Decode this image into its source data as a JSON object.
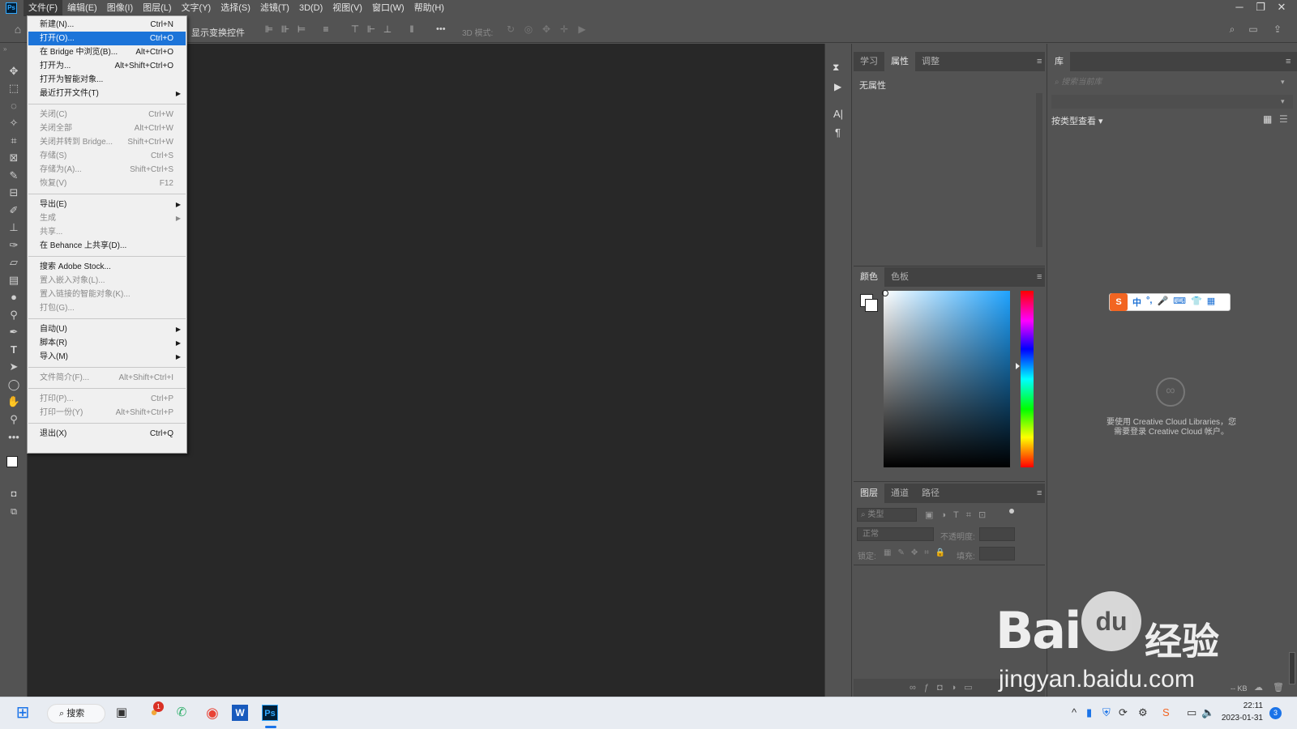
{
  "app": {
    "logo": "Ps"
  },
  "menubar": [
    {
      "label": "文件(F)",
      "active": true
    },
    {
      "label": "编辑(E)"
    },
    {
      "label": "图像(I)"
    },
    {
      "label": "图层(L)"
    },
    {
      "label": "文字(Y)"
    },
    {
      "label": "选择(S)"
    },
    {
      "label": "滤镜(T)"
    },
    {
      "label": "3D(D)"
    },
    {
      "label": "视图(V)"
    },
    {
      "label": "窗口(W)"
    },
    {
      "label": "帮助(H)"
    }
  ],
  "window_controls": {
    "minimize": "─",
    "restore": "❐",
    "close": "✕"
  },
  "options_bar": {
    "show_transform": "显示变换控件",
    "mode_3d": "3D 模式:",
    "more": "•••"
  },
  "file_menu": {
    "items": [
      {
        "label": "新建(N)...",
        "shortcut": "Ctrl+N"
      },
      {
        "label": "打开(O)...",
        "shortcut": "Ctrl+O",
        "highlight": true
      },
      {
        "label": "在 Bridge 中浏览(B)...",
        "shortcut": "Alt+Ctrl+O"
      },
      {
        "label": "打开为...",
        "shortcut": "Alt+Shift+Ctrl+O"
      },
      {
        "label": "打开为智能对象..."
      },
      {
        "label": "最近打开文件(T)",
        "submenu": true
      },
      {
        "sep": true
      },
      {
        "label": "关闭(C)",
        "shortcut": "Ctrl+W",
        "disabled": true
      },
      {
        "label": "关闭全部",
        "shortcut": "Alt+Ctrl+W",
        "disabled": true
      },
      {
        "label": "关闭并转到 Bridge...",
        "shortcut": "Shift+Ctrl+W",
        "disabled": true
      },
      {
        "label": "存储(S)",
        "shortcut": "Ctrl+S",
        "disabled": true
      },
      {
        "label": "存储为(A)...",
        "shortcut": "Shift+Ctrl+S",
        "disabled": true
      },
      {
        "label": "恢复(V)",
        "shortcut": "F12",
        "disabled": true
      },
      {
        "sep": true
      },
      {
        "label": "导出(E)",
        "submenu": true
      },
      {
        "label": "生成",
        "submenu": true,
        "disabled": true
      },
      {
        "label": "共享...",
        "disabled": true
      },
      {
        "label": "在 Behance 上共享(D)..."
      },
      {
        "sep": true
      },
      {
        "label": "搜索 Adobe Stock..."
      },
      {
        "label": "置入嵌入对象(L)...",
        "disabled": true
      },
      {
        "label": "置入链接的智能对象(K)...",
        "disabled": true
      },
      {
        "label": "打包(G)...",
        "disabled": true
      },
      {
        "sep": true
      },
      {
        "label": "自动(U)",
        "submenu": true
      },
      {
        "label": "脚本(R)",
        "submenu": true
      },
      {
        "label": "导入(M)",
        "submenu": true
      },
      {
        "sep": true
      },
      {
        "label": "文件简介(F)...",
        "shortcut": "Alt+Shift+Ctrl+I",
        "disabled": true
      },
      {
        "sep": true
      },
      {
        "label": "打印(P)...",
        "shortcut": "Ctrl+P",
        "disabled": true
      },
      {
        "label": "打印一份(Y)",
        "shortcut": "Alt+Shift+Ctrl+P",
        "disabled": true
      },
      {
        "sep": true
      },
      {
        "label": "退出(X)",
        "shortcut": "Ctrl+Q"
      }
    ]
  },
  "properties_panel": {
    "tabs": [
      "学习",
      "属性",
      "调整"
    ],
    "selected": 1,
    "body": "无属性"
  },
  "color_panel": {
    "tabs": [
      "颜色",
      "色板"
    ],
    "selected": 0,
    "hue_color": "#1fa3ff"
  },
  "layers_panel": {
    "tabs": [
      "图层",
      "通道",
      "路径"
    ],
    "selected": 0,
    "filter_placeholder": "类型",
    "blend_mode": "正常",
    "opacity_label": "不透明度:",
    "lock_label": "锁定:",
    "fill_label": "填充:"
  },
  "library_panel": {
    "tab": "库",
    "search_placeholder": "搜索当前库",
    "view_by": "按类型查看",
    "cc_message_line1": "要使用 Creative Cloud Libraries，您",
    "cc_message_line2": "需要登录 Creative Cloud 帐户。",
    "size": "-- KB"
  },
  "ime_toolbar": {
    "logo": "S",
    "items": [
      "中",
      "°,",
      "🎤",
      "⌨",
      "👕",
      "▦"
    ]
  },
  "taskbar": {
    "search": "搜索",
    "time": "22:11",
    "date": "2023-01-31",
    "notif_count": "3",
    "app_badge": "1"
  },
  "watermark": {
    "line1": "Bai",
    "paw": "du",
    "cn": "经验",
    "url": "jingyan.baidu.com"
  }
}
